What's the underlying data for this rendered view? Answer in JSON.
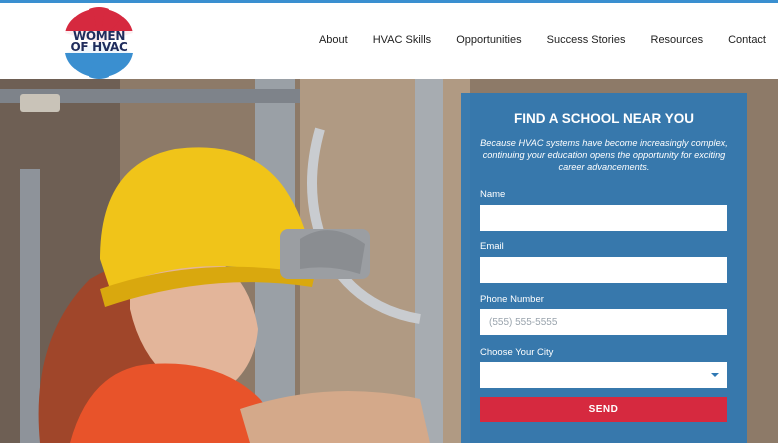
{
  "brand": {
    "logo_line1": "WOMEN",
    "logo_line2": "OF HVAC",
    "colors": {
      "red": "#d6293f",
      "blue": "#2e78b4",
      "navy": "#1f2c5c"
    }
  },
  "nav": {
    "items": [
      {
        "label": "About"
      },
      {
        "label": "HVAC Skills"
      },
      {
        "label": "Opportunities"
      },
      {
        "label": "Success Stories"
      },
      {
        "label": "Resources"
      },
      {
        "label": "Contact"
      }
    ]
  },
  "hero": {
    "image": "photo of woman wearing yellow hard hat working on HVAC ductwork"
  },
  "form": {
    "title": "FIND A SCHOOL NEAR YOU",
    "description": "Because HVAC systems have become increasingly complex, continuing your education opens the opportunity for exciting career advancements.",
    "name_label": "Name",
    "name_value": "",
    "email_label": "Email",
    "email_value": "",
    "phone_label": "Phone Number",
    "phone_placeholder": "(555) 555-5555",
    "city_label": "Choose Your City",
    "city_value": "",
    "submit_label": "SEND"
  }
}
